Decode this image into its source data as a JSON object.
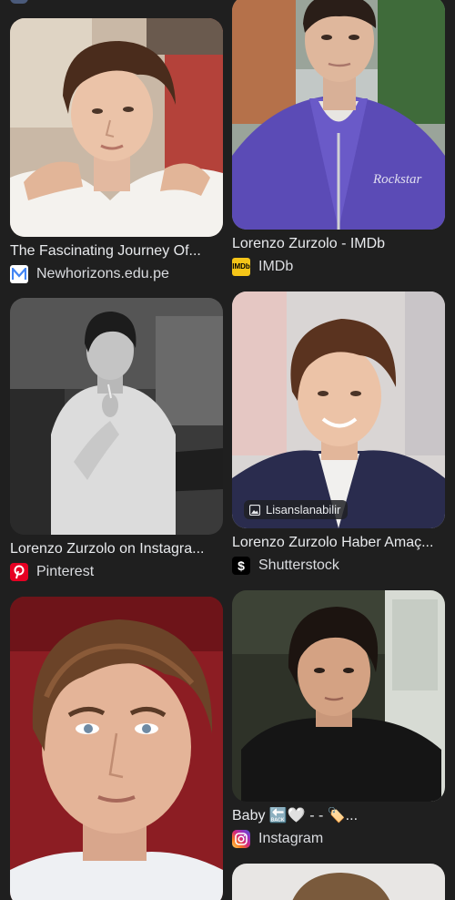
{
  "results": [
    {
      "title": "The Fascinating Journey Of...",
      "source": "Newhorizons.edu.pe",
      "favicon": "newhorizons-logo",
      "accent": "#4285f4"
    },
    {
      "title": "Lorenzo Zurzolo - IMDb",
      "source": "IMDb",
      "favicon": "imdb-logo",
      "accent": "#f5c518",
      "favicon_text": "IMDb",
      "jacket_text": "Rockstar"
    },
    {
      "title": "Lorenzo Zurzolo on Instagra...",
      "source": "Pinterest",
      "favicon": "pinterest-logo",
      "accent": "#e60023"
    },
    {
      "title": "Lorenzo Zurzolo Haber Amaç...",
      "source": "Shutterstock",
      "favicon": "shutterstock-logo",
      "badge": "Lisanslanabilir"
    },
    {
      "title": "",
      "source": "",
      "favicon": "none"
    },
    {
      "title": "Baby 🔙🤍 - - 🏷️...",
      "source": "Instagram",
      "favicon": "instagram-logo"
    }
  ]
}
